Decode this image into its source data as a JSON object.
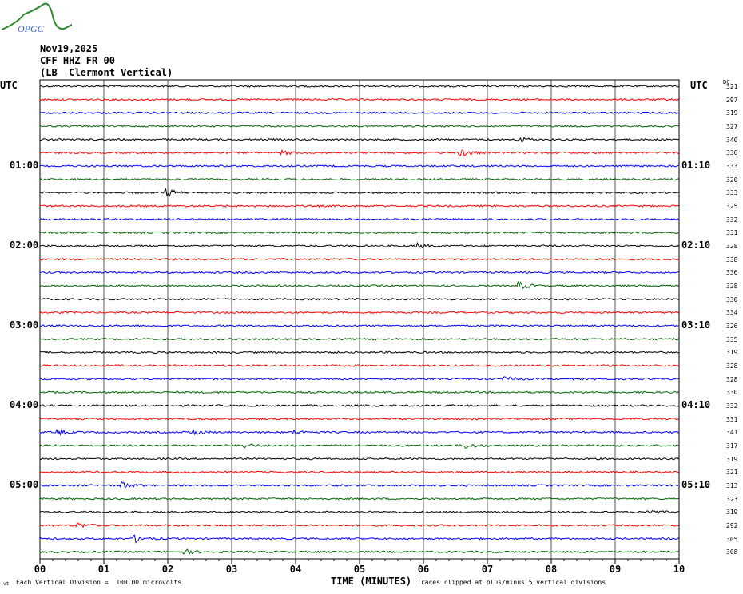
{
  "logo": {
    "text": "OPGC"
  },
  "header": {
    "date": "Nov19,2025",
    "station": "CFF HHZ FR 00",
    "location": "(LB  Clermont Vertical)"
  },
  "left_axis_title": "UTC",
  "right_axis_title": "UTC",
  "dc_title": "DC",
  "footer": {
    "scale_note": "Each Vertical Division =  100.00 microvolts",
    "xlabel": "TIME (MINUTES)",
    "clip_note": "Traces clipped at plus/minus 5 vertical divisions",
    "corner_mark": "vt"
  },
  "colors": {
    "trace_cycle": [
      "#000000",
      "#ff0000",
      "#0000ff",
      "#006400"
    ],
    "grid": "#000000"
  },
  "chart_data": {
    "type": "line",
    "title": "CFF HHZ FR 00 helicorder",
    "xlabel": "TIME (MINUTES)",
    "xlim": [
      0,
      10
    ],
    "x_ticks": [
      "00",
      "01",
      "02",
      "03",
      "04",
      "05",
      "06",
      "07",
      "08",
      "09",
      "10"
    ],
    "grid": "vertical lines each minute",
    "trace_count": 36,
    "minutes_per_trace": 10,
    "left_time_labels": [
      {
        "trace": 6,
        "label": "01:00"
      },
      {
        "trace": 12,
        "label": "02:00"
      },
      {
        "trace": 18,
        "label": "03:00"
      },
      {
        "trace": 24,
        "label": "04:00"
      },
      {
        "trace": 30,
        "label": "05:00"
      }
    ],
    "right_time_labels": [
      {
        "trace": 6,
        "label": "01:10"
      },
      {
        "trace": 12,
        "label": "02:10"
      },
      {
        "trace": 18,
        "label": "03:10"
      },
      {
        "trace": 24,
        "label": "04:10"
      },
      {
        "trace": 30,
        "label": "05:10"
      }
    ],
    "dc_offsets": [
      321,
      297,
      319,
      327,
      340,
      336,
      333,
      320,
      333,
      325,
      332,
      331,
      328,
      338,
      336,
      328,
      330,
      334,
      326,
      335,
      319,
      328,
      328,
      330,
      332,
      331,
      341,
      317,
      319,
      321,
      313,
      323,
      319,
      292,
      305,
      308
    ],
    "events": [
      {
        "trace": 4,
        "minute": 7.5,
        "amp": 2
      },
      {
        "trace": 5,
        "minute": 6.6,
        "amp": 3
      },
      {
        "trace": 5,
        "minute": 3.8,
        "amp": 1.5
      },
      {
        "trace": 8,
        "minute": 2.0,
        "amp": 3
      },
      {
        "trace": 12,
        "minute": 5.9,
        "amp": 2
      },
      {
        "trace": 15,
        "minute": 7.5,
        "amp": 3
      },
      {
        "trace": 22,
        "minute": 7.3,
        "amp": 2
      },
      {
        "trace": 26,
        "minute": 0.3,
        "amp": 2
      },
      {
        "trace": 26,
        "minute": 2.4,
        "amp": 2.5
      },
      {
        "trace": 26,
        "minute": 4.0,
        "amp": 1.5
      },
      {
        "trace": 27,
        "minute": 3.2,
        "amp": 2
      },
      {
        "trace": 27,
        "minute": 6.7,
        "amp": 2
      },
      {
        "trace": 30,
        "minute": 1.3,
        "amp": 2.5
      },
      {
        "trace": 32,
        "minute": 9.5,
        "amp": 2
      },
      {
        "trace": 33,
        "minute": 0.6,
        "amp": 2
      },
      {
        "trace": 34,
        "minute": 1.5,
        "amp": 2.5
      },
      {
        "trace": 35,
        "minute": 2.3,
        "amp": 1.5
      }
    ]
  }
}
